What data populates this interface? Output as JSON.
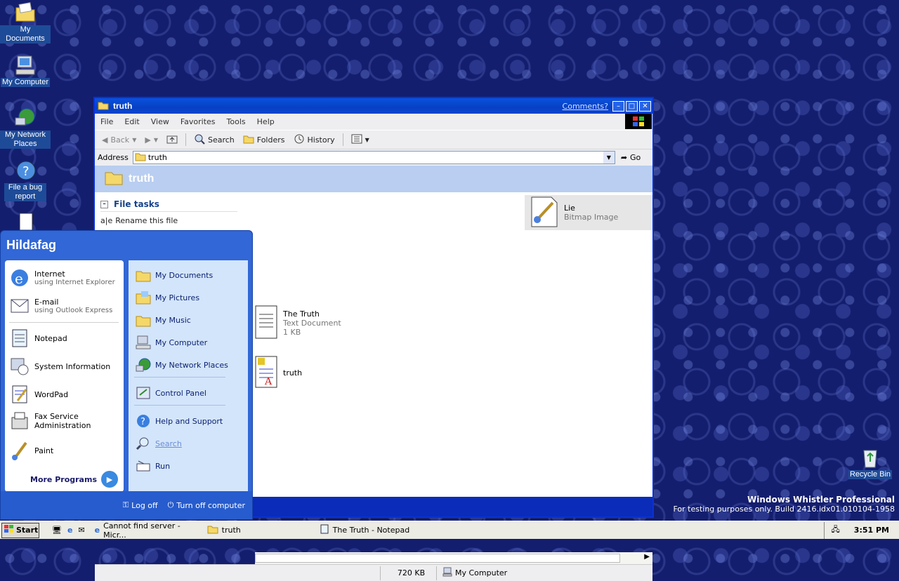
{
  "desktop_icons": [
    {
      "label": "My Documents",
      "icon": "my-documents-icon"
    },
    {
      "label": "My Computer",
      "icon": "my-computer-icon"
    },
    {
      "label": "My Network Places",
      "icon": "network-places-icon"
    },
    {
      "label": "File a bug report",
      "icon": "bug-report-icon"
    },
    {
      "label": "Recycle Bin",
      "icon": "recycle-bin-icon"
    }
  ],
  "window": {
    "title": "truth",
    "comments": "Comments?",
    "menu": [
      "File",
      "Edit",
      "View",
      "Favorites",
      "Tools",
      "Help"
    ],
    "toolbar": {
      "back": "Back",
      "search": "Search",
      "folders": "Folders",
      "history": "History"
    },
    "address_label": "Address",
    "address_value": "truth",
    "go": "Go",
    "header_title": "truth",
    "file_tasks": {
      "title": "File tasks",
      "rename": "Rename this file"
    },
    "files": [
      {
        "name": "Lie",
        "type": "Bitmap Image",
        "size": ""
      },
      {
        "name": "The Truth",
        "type": "Text Document",
        "size": "1 KB"
      },
      {
        "name": "truth",
        "type": "",
        "size": ""
      }
    ],
    "status": {
      "size": "720 KB",
      "location": "My Computer"
    }
  },
  "start_menu": {
    "user": "Hildafag",
    "pinned": [
      {
        "name": "Internet",
        "sub": "using Internet Explorer"
      },
      {
        "name": "E-mail",
        "sub": "using Outlook Express"
      }
    ],
    "programs": [
      "Notepad",
      "System Information",
      "WordPad",
      "Fax Service Administration",
      "Paint"
    ],
    "more_programs": "More Programs",
    "places": [
      "My Documents",
      "My Pictures",
      "My Music",
      "My Computer",
      "My Network Places",
      "Control Panel",
      "Help and Support",
      "Search",
      "Run"
    ],
    "log_off": "Log off",
    "turn_off": "Turn off computer"
  },
  "taskbar": {
    "start": "Start",
    "items": [
      "Cannot find server - Micr...",
      "truth",
      "The Truth - Notepad"
    ],
    "clock": "3:51 PM"
  },
  "watermark": {
    "line1": "Windows Whistler Professional",
    "line2": "For testing purposes only. Build 2416.idx01.010104-1958"
  },
  "colors": {
    "desktop": "#141e6e",
    "titlebar": "#0a52dd",
    "startmenu": "#3167d6",
    "taskbar": "#ecebe4"
  }
}
